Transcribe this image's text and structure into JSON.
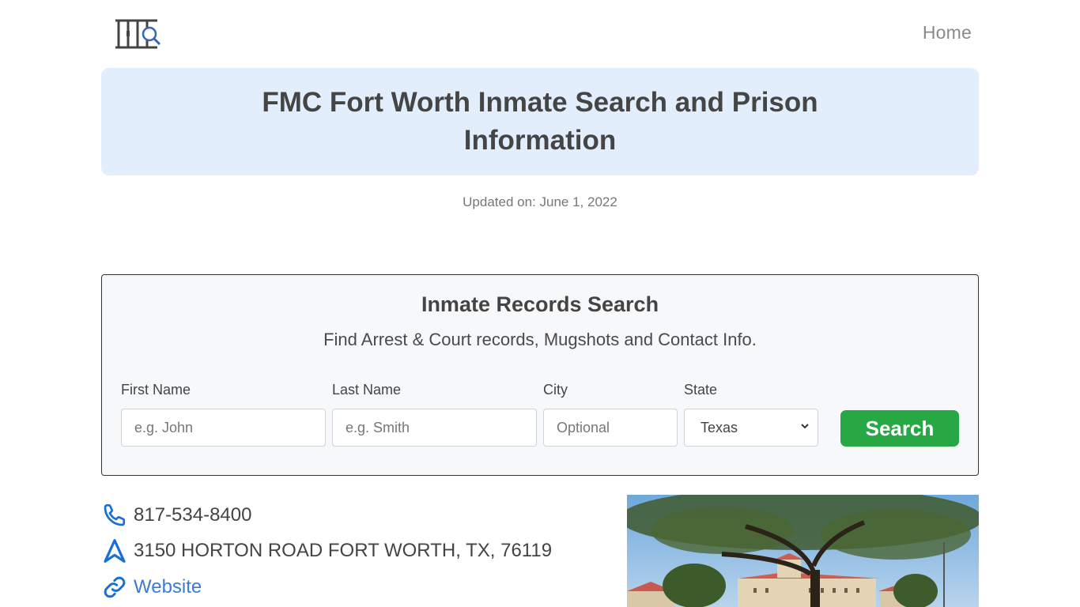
{
  "header": {
    "logo_icon": "jail-bars-search-icon",
    "nav_home": "Home"
  },
  "hero": {
    "title": "FMC Fort Worth Inmate Search and Prison Information"
  },
  "updated": "Updated on: June 1, 2022",
  "search": {
    "title": "Inmate Records Search",
    "subtitle": "Find Arrest & Court records, Mugshots and Contact Info.",
    "fields": [
      {
        "label": "First Name",
        "placeholder": "e.g. John"
      },
      {
        "label": "Last Name",
        "placeholder": "e.g. Smith"
      },
      {
        "label": "City",
        "placeholder": "Optional"
      },
      {
        "label": "State",
        "value": "Texas"
      }
    ],
    "button": "Search"
  },
  "contact": {
    "phone": "817-534-8400",
    "address": "3150 HORTON ROAD FORT WORTH, TX, 76119",
    "website": "Website"
  },
  "colors": {
    "accent_blue": "#1a6fd6",
    "button_green": "#28a745",
    "hero_bg": "#e3eefc"
  }
}
